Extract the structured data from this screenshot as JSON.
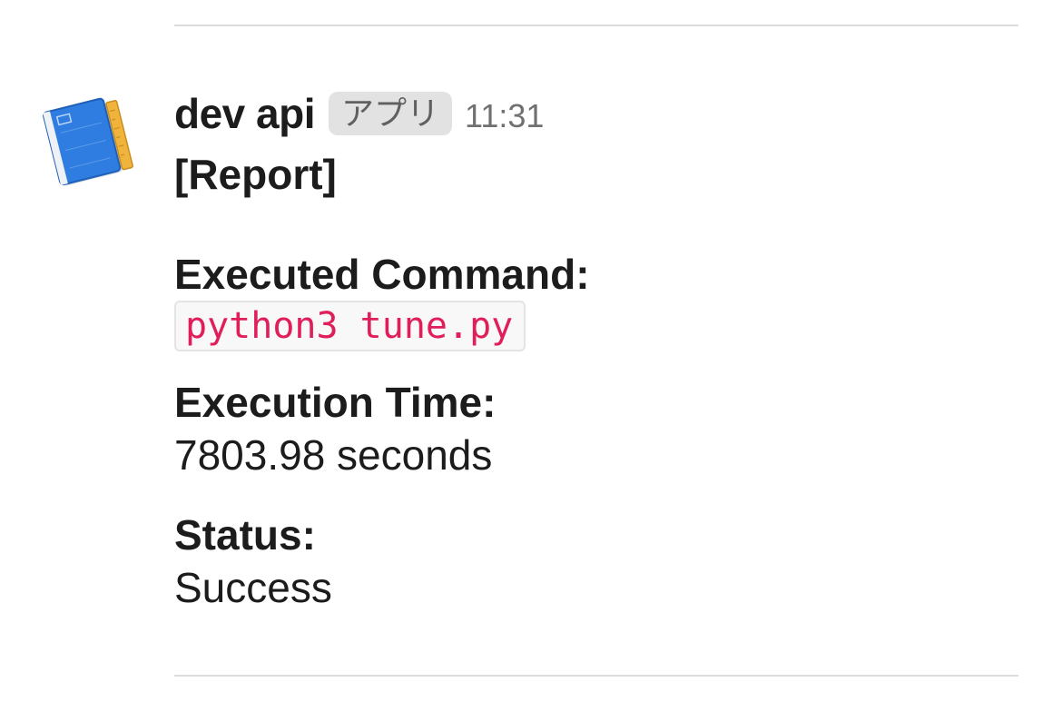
{
  "message": {
    "sender": "dev api",
    "badge": "アプリ",
    "timestamp": "11:31",
    "title": "[Report]",
    "fields": [
      {
        "label": "Executed Command:",
        "value": "python3 tune.py",
        "style": "code"
      },
      {
        "label": "Execution Time:",
        "value": "7803.98 seconds",
        "style": "text"
      },
      {
        "label": "Status:",
        "value": "Success",
        "style": "text"
      }
    ]
  },
  "avatar": {
    "icon": "blueprint-book-icon",
    "colors": {
      "book": "#2f7de0",
      "ruler": "#f0b43c",
      "page": "#e8e8e8"
    }
  },
  "colors": {
    "code_text": "#e01e5a",
    "badge_bg": "#e2e2e2",
    "divider": "#dddddd"
  }
}
